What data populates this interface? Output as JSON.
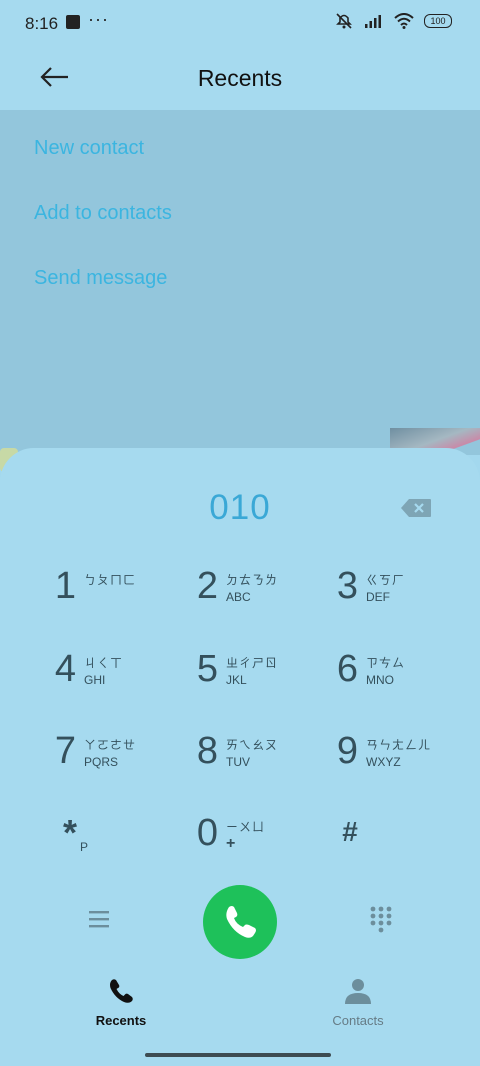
{
  "status_bar": {
    "time": "8:16",
    "battery": "100"
  },
  "header": {
    "title": "Recents"
  },
  "menu": {
    "items": [
      {
        "label": "New contact"
      },
      {
        "label": "Add to contacts"
      },
      {
        "label": "Send message"
      }
    ]
  },
  "dialer": {
    "number": "010",
    "keys": [
      {
        "digit": "1",
        "bpmf": "ㄅㄆㄇㄈ",
        "letters": ""
      },
      {
        "digit": "2",
        "bpmf": "ㄉㄊㄋㄌ",
        "letters": "ABC"
      },
      {
        "digit": "3",
        "bpmf": "ㄍㄎㄏ",
        "letters": "DEF"
      },
      {
        "digit": "4",
        "bpmf": "ㄐㄑㄒ",
        "letters": "GHI"
      },
      {
        "digit": "5",
        "bpmf": "ㄓㄔㄕㄖ",
        "letters": "JKL"
      },
      {
        "digit": "6",
        "bpmf": "ㄗㄘㄙ",
        "letters": "MNO"
      },
      {
        "digit": "7",
        "bpmf": "ㄚㄛㄜㄝ",
        "letters": "PQRS"
      },
      {
        "digit": "8",
        "bpmf": "ㄞㄟㄠㄡ",
        "letters": "TUV"
      },
      {
        "digit": "9",
        "bpmf": "ㄢㄣㄤㄥㄦ",
        "letters": "WXYZ"
      },
      {
        "digit": "0",
        "bpmf": "ㄧㄨㄩ",
        "letters": "+"
      }
    ],
    "star": {
      "symbol": "*",
      "sub": "P"
    },
    "hash": {
      "symbol": "#"
    }
  },
  "bottom_nav": {
    "items": [
      {
        "label": "Recents",
        "icon": "phone-icon",
        "active": true
      },
      {
        "label": "Contacts",
        "icon": "person-icon",
        "active": false
      }
    ]
  },
  "colors": {
    "background": "#a3d8ee",
    "accent": "#3bb5e0",
    "call_button": "#1ec15a",
    "key_text": "#34505c"
  }
}
